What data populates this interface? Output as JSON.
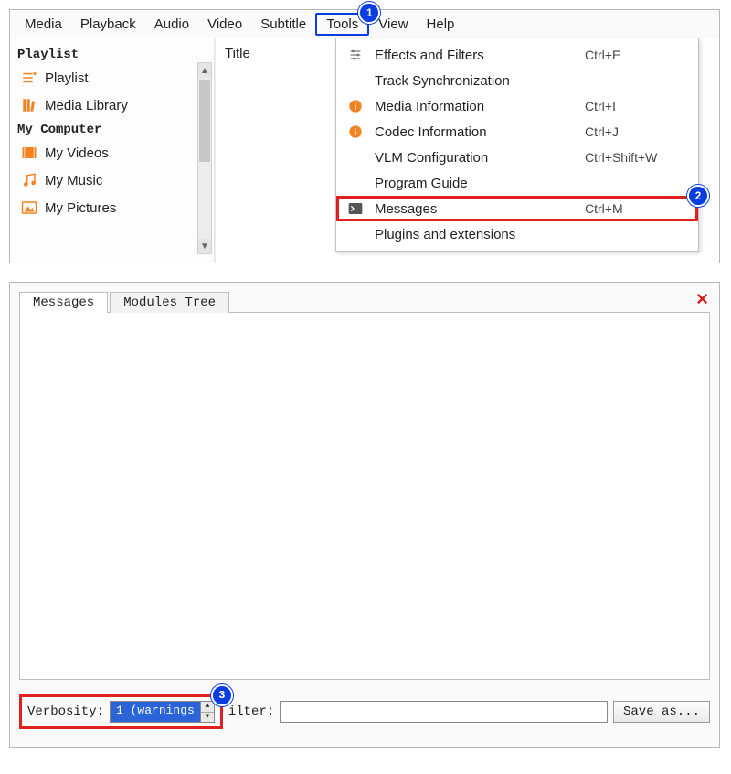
{
  "menubar": [
    "Media",
    "Playback",
    "Audio",
    "Video",
    "Subtitle",
    "Tools",
    "View",
    "Help"
  ],
  "menubar_active_index": 5,
  "badges": {
    "tools": "1",
    "messages": "2",
    "verbosity": "3"
  },
  "sidebar": {
    "section1": "Playlist",
    "items1": [
      "Playlist",
      "Media Library"
    ],
    "section2": "My Computer",
    "items2": [
      "My Videos",
      "My Music",
      "My Pictures"
    ]
  },
  "playlist_header": "Title",
  "dropdown": [
    {
      "icon": "sliders",
      "label": "Effects and Filters",
      "shortcut": "Ctrl+E"
    },
    {
      "icon": "",
      "label": "Track Synchronization",
      "shortcut": ""
    },
    {
      "icon": "info",
      "label": "Media Information",
      "shortcut": "Ctrl+I"
    },
    {
      "icon": "info",
      "label": "Codec Information",
      "shortcut": "Ctrl+J"
    },
    {
      "icon": "",
      "label": "VLM Configuration",
      "shortcut": "Ctrl+Shift+W"
    },
    {
      "icon": "",
      "label": "Program Guide",
      "shortcut": ""
    },
    {
      "icon": "terminal",
      "label": "Messages",
      "shortcut": "Ctrl+M",
      "highlight": true
    },
    {
      "icon": "",
      "label": "Plugins and extensions",
      "shortcut": ""
    }
  ],
  "messages_window": {
    "tabs": [
      "Messages",
      "Modules Tree"
    ],
    "active_tab": 0,
    "close": "×",
    "verbosity_label": "Verbosity:",
    "verbosity_value": "1 (warnings",
    "filter_label": "ilter:",
    "save_label": "Save as..."
  }
}
